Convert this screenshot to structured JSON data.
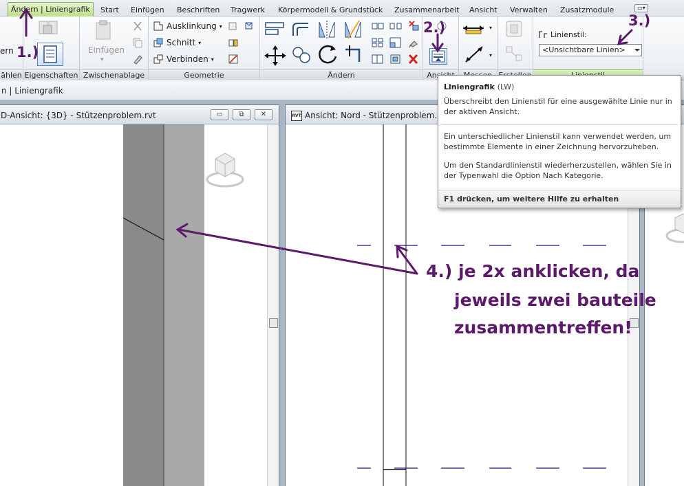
{
  "tabs": [
    {
      "label": "Ändern | Liniengrafik",
      "active": true
    },
    {
      "label": "Start"
    },
    {
      "label": "Einfügen"
    },
    {
      "label": "Beschriften"
    },
    {
      "label": "Tragwerk"
    },
    {
      "label": "Körpermodell & Grundstück"
    },
    {
      "label": "Zusammenarbeit"
    },
    {
      "label": "Ansicht"
    },
    {
      "label": "Verwalten"
    },
    {
      "label": "Zusatzmodule"
    }
  ],
  "ribbon": {
    "panels": {
      "waehlen": "ählen",
      "eigenschaften": "Eigenschaften",
      "zwischenablage": "Zwischenablage",
      "geometrie": "Geometrie",
      "aendern": "Ändern",
      "ansicht": "Ansicht",
      "messen": "Messen",
      "erstellen": "Erstellen",
      "linienstil": "Linienstil"
    },
    "partial_label": "ern",
    "einfuegen": "Einfügen",
    "ausklinkung": "Ausklinkung",
    "schnitt": "Schnitt",
    "verbinden": "Verbinden",
    "linienstil_label": "Linienstil:",
    "linienstil_value": "<Unsichtbare Linien>"
  },
  "context_bar": {
    "label": "n | Liniengrafik"
  },
  "views": {
    "left": {
      "title": "D-Ansicht: {3D} - Stützenproblem.rvt"
    },
    "right": {
      "title": "Ansicht: Nord - Stützenproblem.rvt",
      "icon_text": "RVT"
    }
  },
  "window_buttons": {
    "minimize": "▭",
    "restore": "⧉",
    "close": "✕"
  },
  "tooltip": {
    "title": "Liniengrafik",
    "shortcut": "(LW)",
    "description": "Überschreibt den Linienstil für eine ausgewählte Linie nur in der aktiven Ansicht.",
    "p1": "Ein unterschiedlicher Linienstil kann verwendet werden, um bestimmte Elemente in einer Zeichnung hervorzuheben.",
    "p2": "Um den Standardlinienstil wiederherzustellen, wählen Sie in der Typenwahl die Option Nach Kategorie.",
    "footer": "F1 drücken, um weitere Hilfe zu erhalten"
  },
  "annotations": {
    "step1": "1.)",
    "step2": "2.)",
    "step3": "3.)",
    "step4_line1": "4.) je 2x anklicken, da",
    "step4_line2": "jeweils zwei bauteile",
    "step4_line3": "zusammentreffen!"
  },
  "colors": {
    "annotation": "#5b1a6a",
    "active_tab": "#b8dc86",
    "column_dark": "#8a8a8a",
    "column_light": "#a9a9a9",
    "dashed_line": "#1a1a8c"
  }
}
